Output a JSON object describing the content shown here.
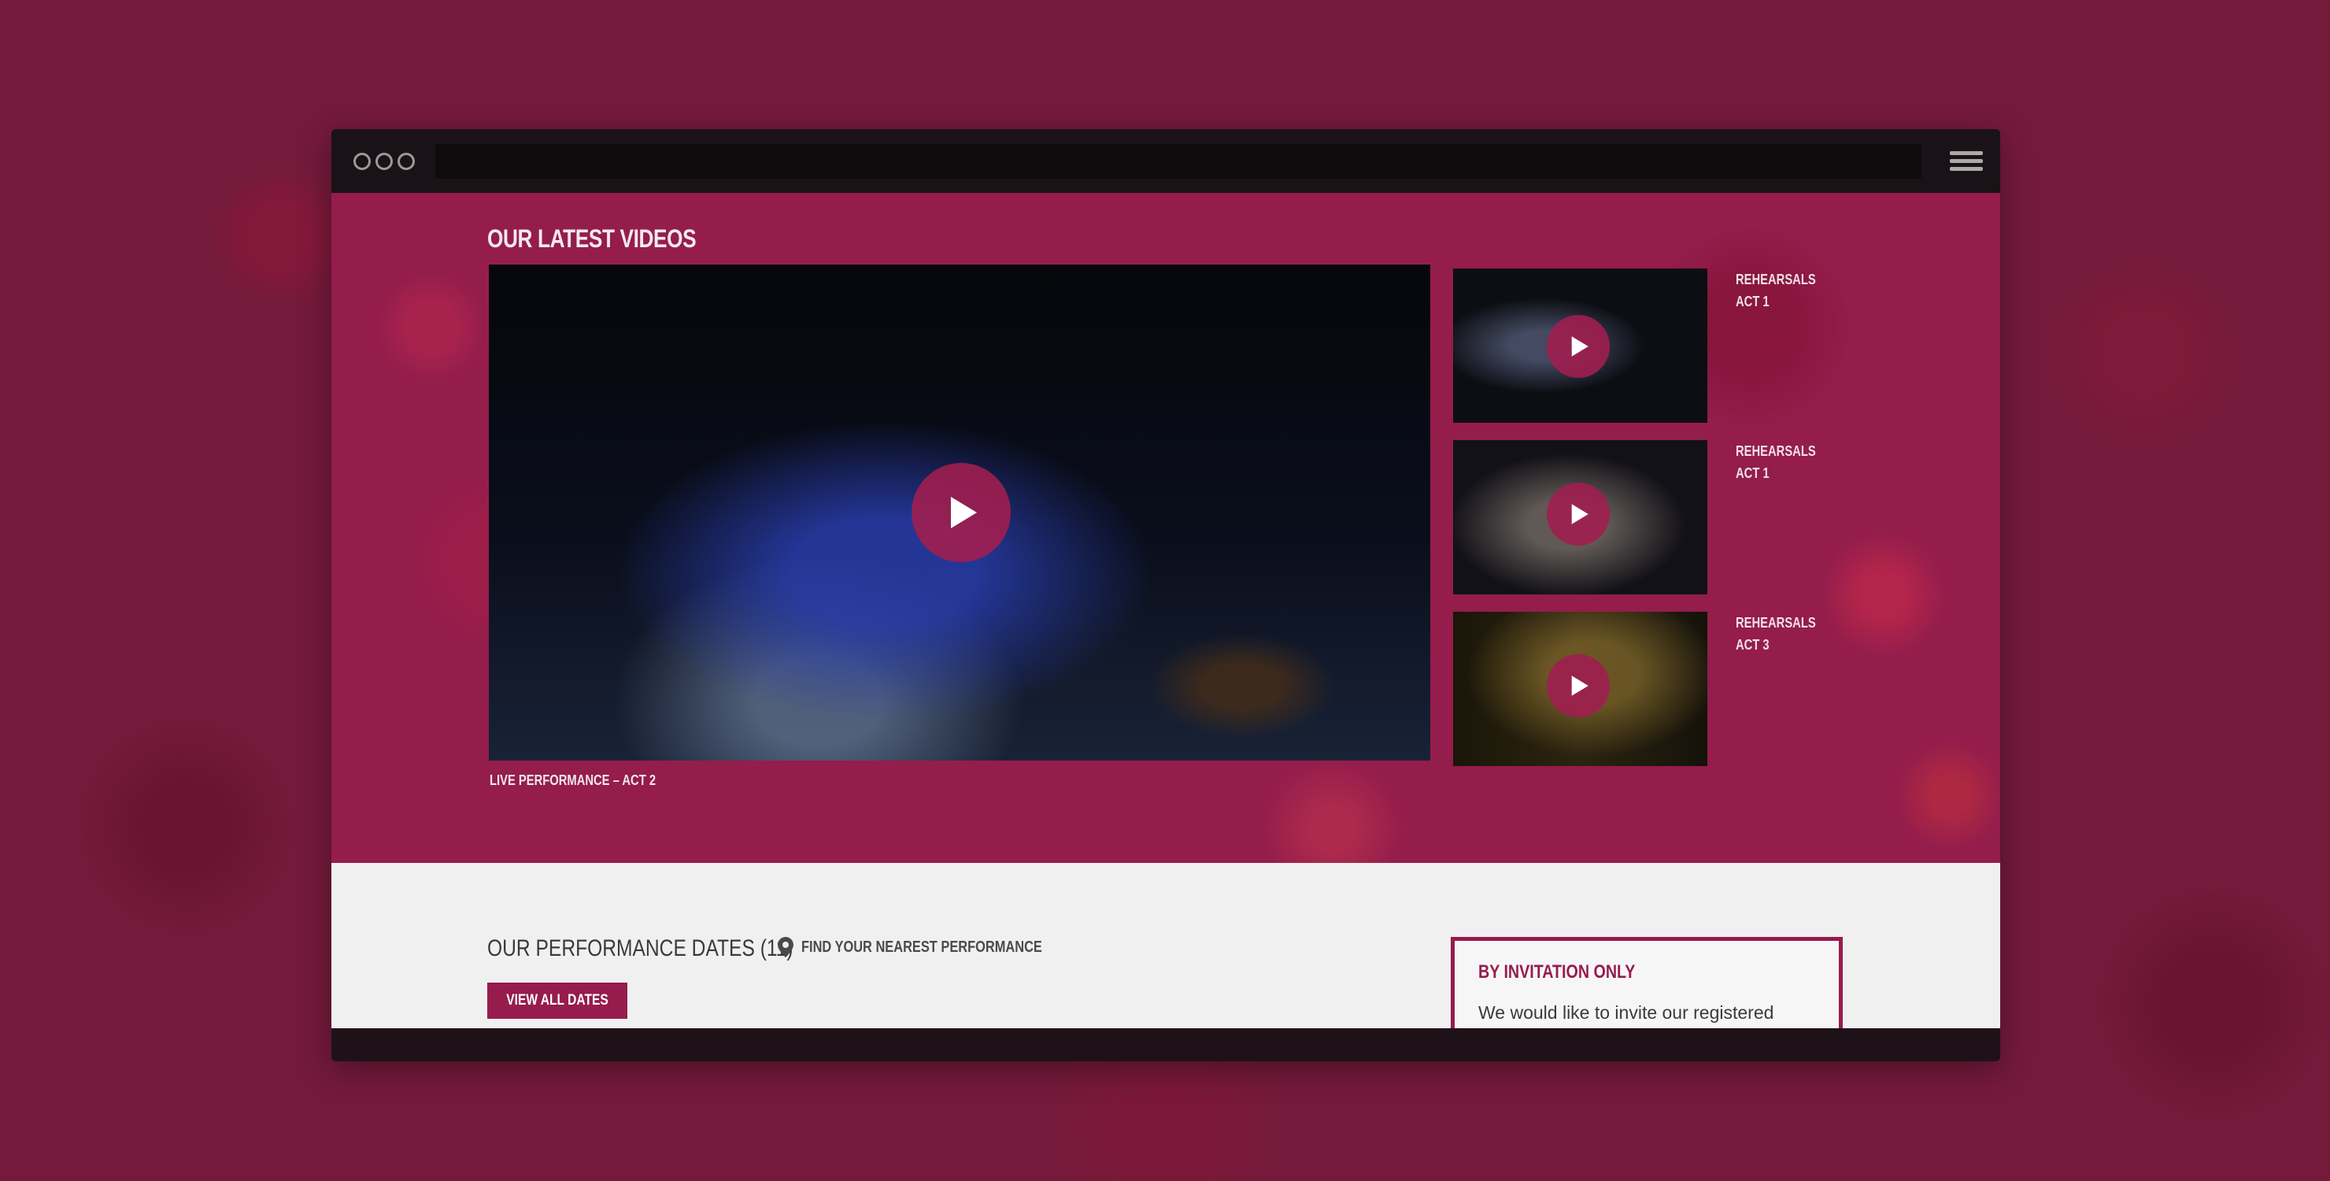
{
  "colors": {
    "page_background": "#741a3a",
    "accent": "#961c4e",
    "video_section_background": "#941d4b",
    "dates_section_background": "#f1f0f0",
    "browser_chrome": "#1a1216"
  },
  "browser": {
    "window_controls": [
      "circle",
      "circle",
      "circle"
    ],
    "address_bar_value": "",
    "menu_icon": "hamburger-icon"
  },
  "videos": {
    "title": "OUR LATEST VIDEOS",
    "main": {
      "caption": "LIVE PERFORMANCE – ACT 2",
      "play_icon": "play-icon"
    },
    "thumbnails": [
      {
        "line1": "REHEARSALS",
        "line2": "ACT 1",
        "play_icon": "play-icon"
      },
      {
        "line1": "REHEARSALS",
        "line2": "ACT 1",
        "play_icon": "play-icon"
      },
      {
        "line1": "REHEARSALS",
        "line2": "ACT 3",
        "play_icon": "play-icon"
      }
    ]
  },
  "performance_dates": {
    "title": "OUR PERFORMANCE DATES (11)",
    "find_link": "FIND YOUR NEAREST PERFORMANCE",
    "find_icon": "map-pin-icon",
    "view_all_label": "VIEW ALL DATES"
  },
  "invitation": {
    "title": "BY INVITATION ONLY",
    "text": "We would like to invite our registered"
  }
}
